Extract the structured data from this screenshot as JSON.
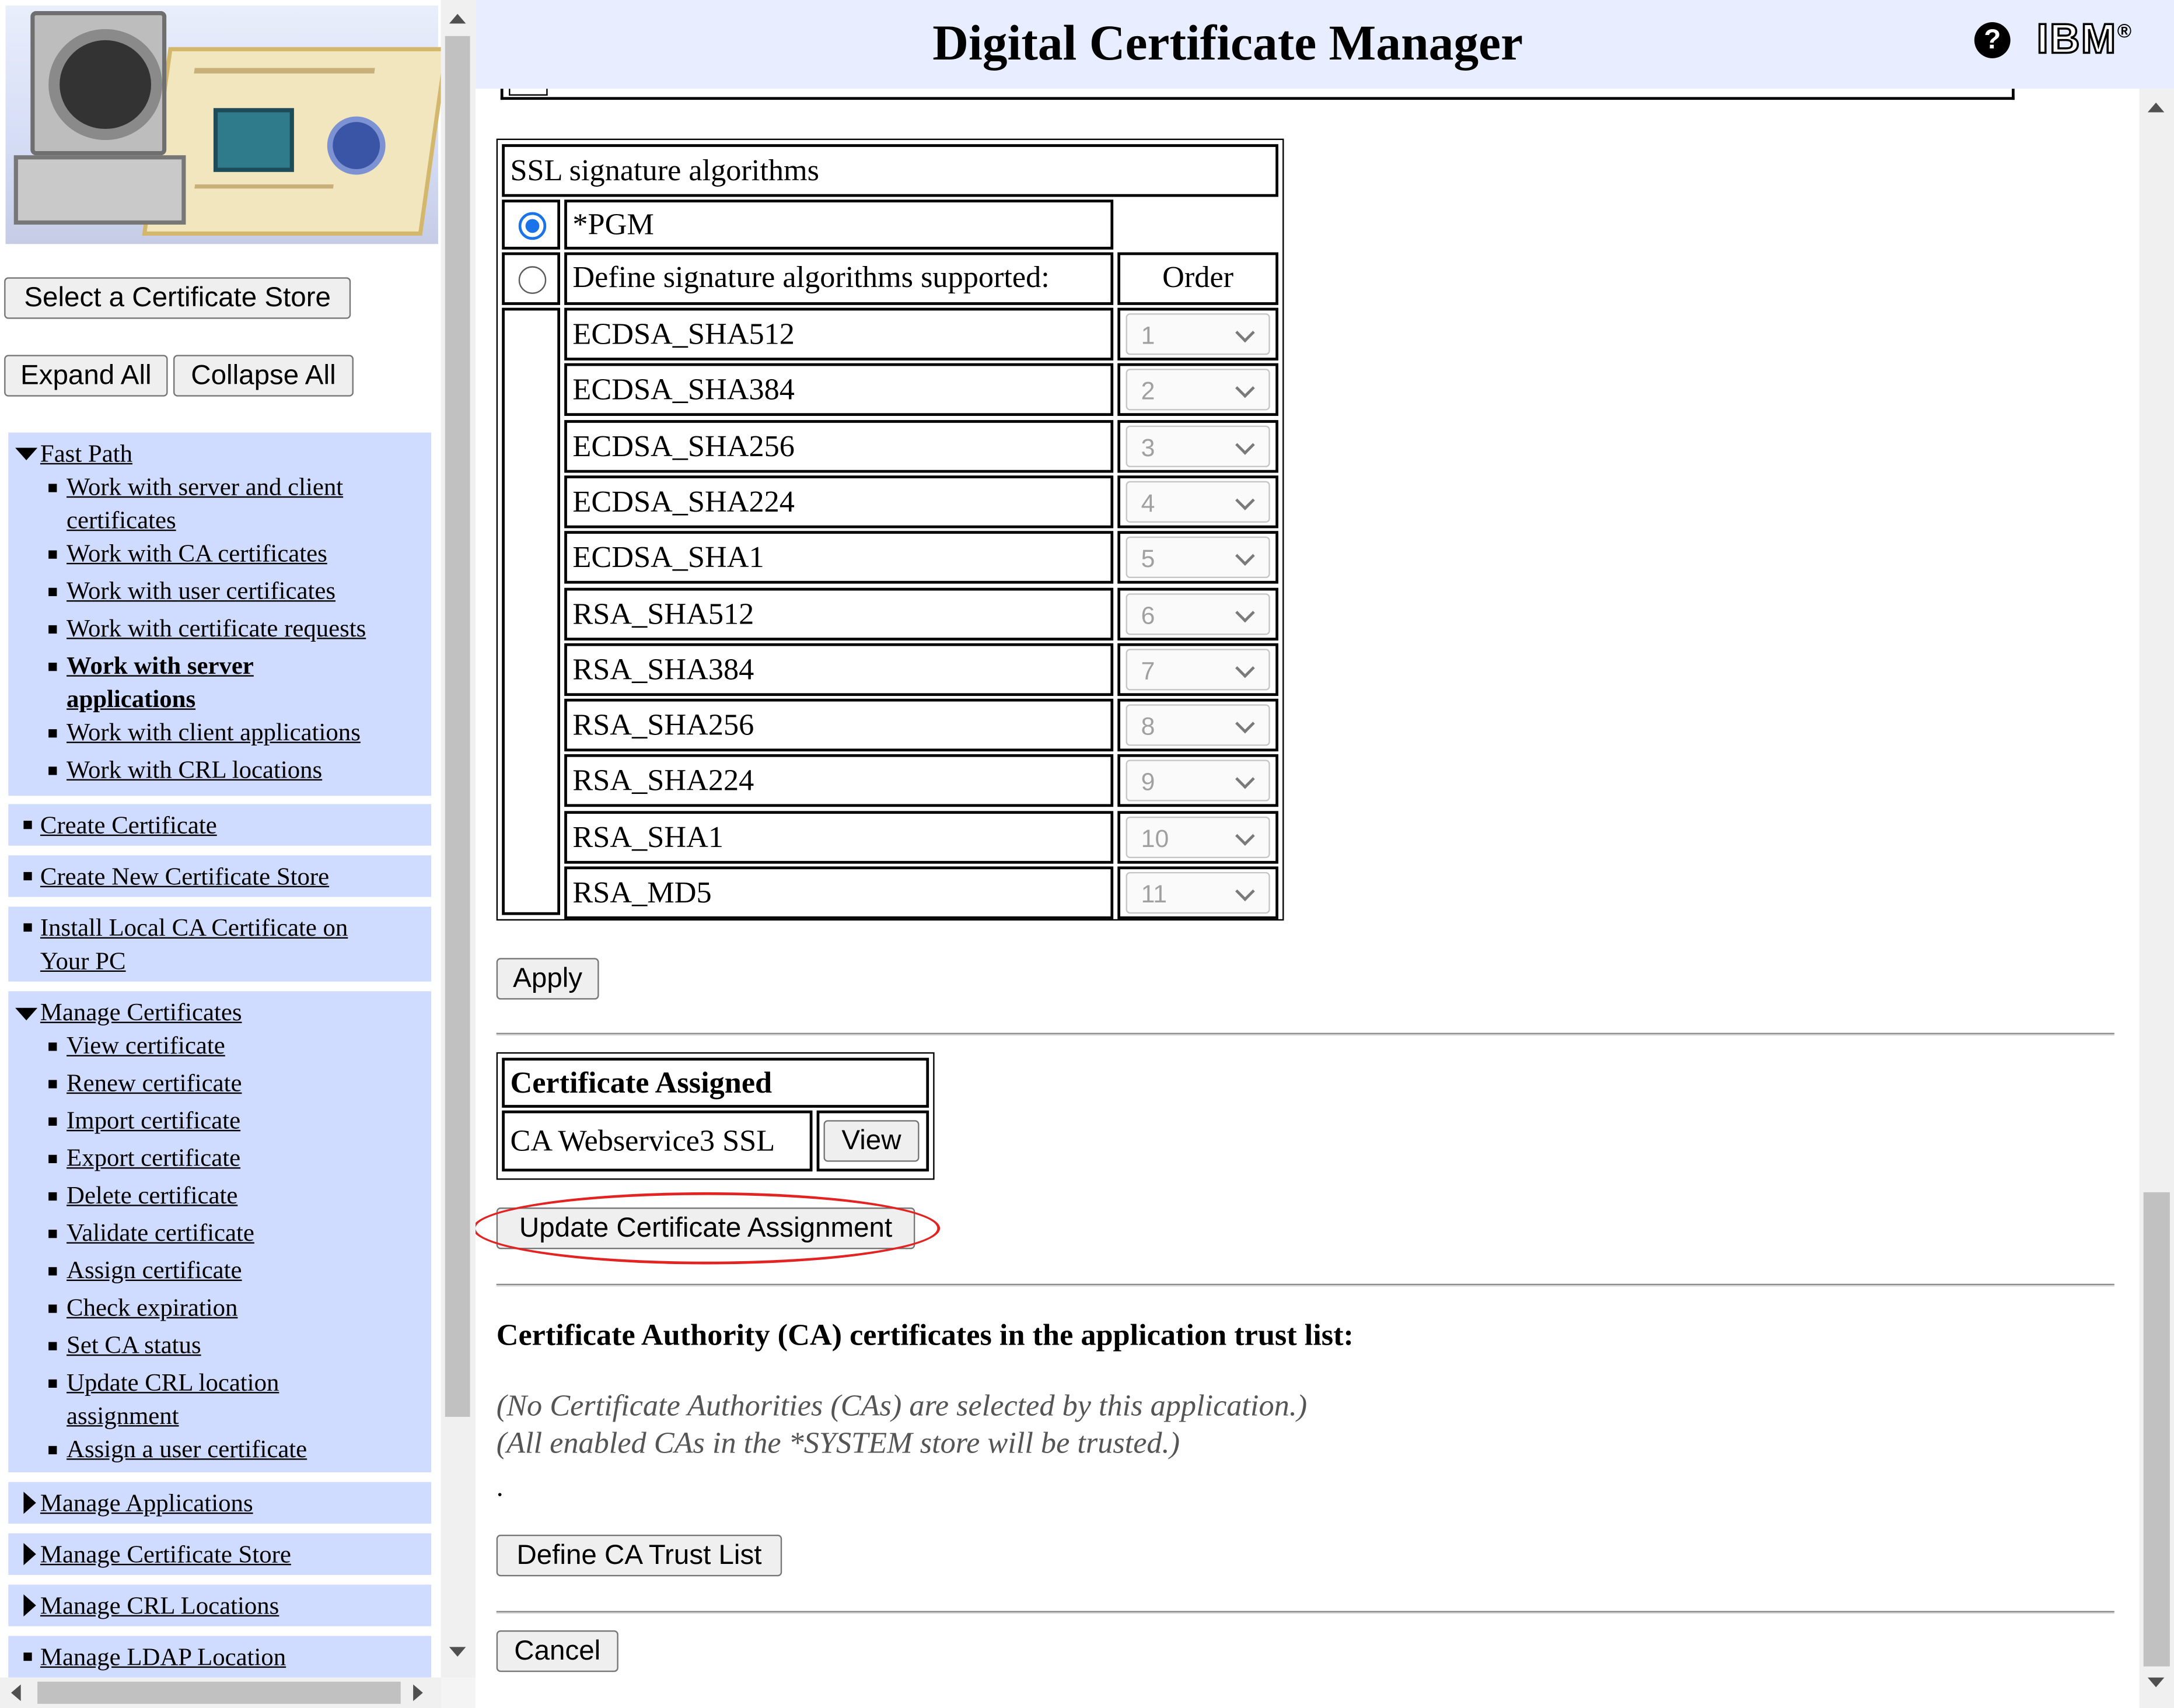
{
  "header": {
    "title": "Digital Certificate Manager",
    "help_icon": "?",
    "logo_text": "IBM",
    "logo_mark": "®"
  },
  "sidebar": {
    "select_store_button": "Select a Certificate Store",
    "expand_all_button": "Expand All",
    "collapse_all_button": "Collapse All",
    "fast_path": {
      "label": "Fast Path",
      "items": [
        {
          "line1": "Work with server and client",
          "line2": "certificates",
          "bold": false
        },
        {
          "line1": "Work with CA certificates",
          "line2": "",
          "bold": false
        },
        {
          "line1": "Work with user certificates",
          "line2": "",
          "bold": false
        },
        {
          "line1": "Work with certificate requests",
          "line2": "",
          "bold": false
        },
        {
          "line1": "Work with server",
          "line2": "applications",
          "bold": true
        },
        {
          "line1": "Work with client applications",
          "line2": "",
          "bold": false
        },
        {
          "line1": "Work with CRL locations",
          "line2": "",
          "bold": false
        }
      ]
    },
    "create_certificate": "Create Certificate",
    "create_new_store": "Create New Certificate Store",
    "install_local_ca_line1": "Install Local CA Certificate on",
    "install_local_ca_line2": "Your PC",
    "manage_certificates": {
      "label": "Manage Certificates",
      "items": [
        {
          "line1": "View certificate",
          "line2": ""
        },
        {
          "line1": "Renew certificate",
          "line2": ""
        },
        {
          "line1": "Import certificate",
          "line2": ""
        },
        {
          "line1": "Export certificate",
          "line2": ""
        },
        {
          "line1": "Delete certificate",
          "line2": ""
        },
        {
          "line1": "Validate certificate",
          "line2": ""
        },
        {
          "line1": "Assign certificate",
          "line2": ""
        },
        {
          "line1": "Check expiration",
          "line2": ""
        },
        {
          "line1": "Set CA status",
          "line2": ""
        },
        {
          "line1": "Update CRL location",
          "line2": "assignment"
        },
        {
          "line1": "Assign a user certificate",
          "line2": ""
        }
      ]
    },
    "manage_applications": "Manage Applications",
    "manage_certificate_store": "Manage Certificate Store",
    "manage_crl_locations": "Manage CRL Locations",
    "manage_ldap_location": "Manage LDAP Location"
  },
  "ssl_sig": {
    "heading": "SSL signature algorithms",
    "option_pgm": "*PGM",
    "option_define": "Define signature algorithms supported:",
    "order_header": "Order",
    "selected": "pgm",
    "rows": [
      {
        "name": "ECDSA_SHA512",
        "order": "1"
      },
      {
        "name": "ECDSA_SHA384",
        "order": "2"
      },
      {
        "name": "ECDSA_SHA256",
        "order": "3"
      },
      {
        "name": "ECDSA_SHA224",
        "order": "4"
      },
      {
        "name": "ECDSA_SHA1",
        "order": "5"
      },
      {
        "name": "RSA_SHA512",
        "order": "6"
      },
      {
        "name": "RSA_SHA384",
        "order": "7"
      },
      {
        "name": "RSA_SHA256",
        "order": "8"
      },
      {
        "name": "RSA_SHA224",
        "order": "9"
      },
      {
        "name": "RSA_SHA1",
        "order": "10"
      },
      {
        "name": "RSA_MD5",
        "order": "11"
      }
    ]
  },
  "apply_button": "Apply",
  "cert_assigned": {
    "heading": "Certificate Assigned",
    "value": "CA Webservice3 SSL",
    "view_button": "View"
  },
  "update_assignment_button": "Update Certificate Assignment",
  "ca_trust": {
    "heading": "Certificate Authority (CA) certificates in the application trust list:",
    "note1": "(No Certificate Authorities (CAs) are selected by this application.)",
    "note2": "(All enabled CAs in the *SYSTEM store will be trusted.)",
    "dot": ".",
    "define_button": "Define CA Trust List"
  },
  "cancel_button": "Cancel",
  "colors": {
    "nav_bg": "#cfdcff",
    "header_bg": "#e8eeff",
    "highlight": "#e32222",
    "radio_selected": "#1a73e8"
  }
}
